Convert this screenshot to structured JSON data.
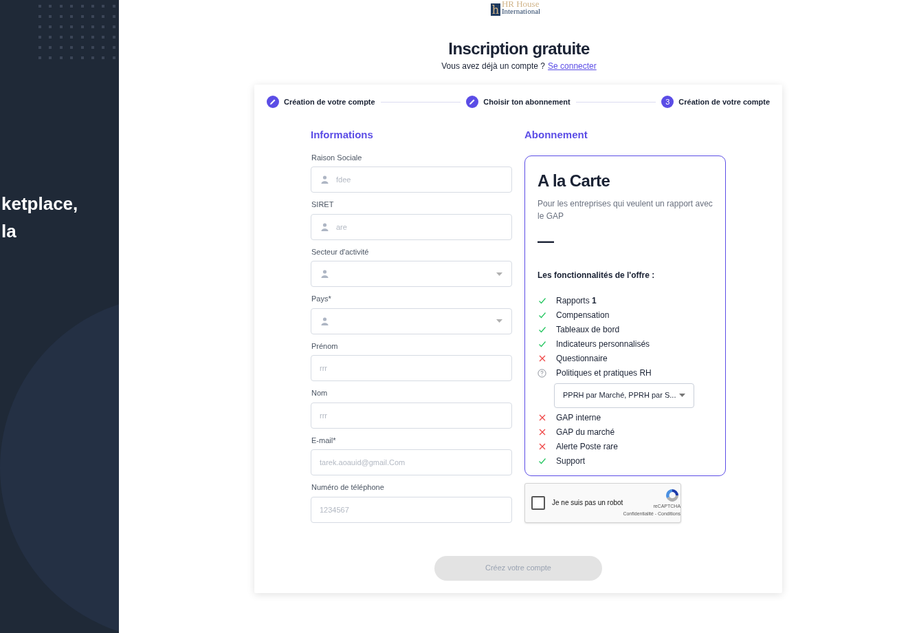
{
  "left_panel": {
    "text_lines": [
      "ketplace,",
      "la"
    ]
  },
  "logo": {
    "mark": "h",
    "name": "HR House",
    "subtitle": "International"
  },
  "header": {
    "title": "Inscription gratuite",
    "question": "Vous avez déjà un compte ?",
    "link": "Se connecter"
  },
  "steps": [
    {
      "label": "Création de votre compte",
      "done": true
    },
    {
      "label": "Choisir ton abonnement",
      "done": true
    },
    {
      "label": "Création de votre compte",
      "done": false,
      "number": "3"
    }
  ],
  "informations": {
    "title": "Informations",
    "fields": [
      {
        "kind": "text",
        "label": "Raison Sociale",
        "placeholder": "fdee",
        "icon": true
      },
      {
        "kind": "text",
        "label": "SIRET",
        "placeholder": "are",
        "icon": true
      },
      {
        "kind": "select",
        "label": "Secteur d'activité",
        "icon": true
      },
      {
        "kind": "select",
        "label": "Pays*",
        "icon": true
      },
      {
        "kind": "text",
        "label": "Prénom",
        "placeholder": "rrr",
        "icon": false
      },
      {
        "kind": "text",
        "label": "Nom",
        "placeholder": "rrr",
        "icon": false
      },
      {
        "kind": "text",
        "label": "E-mail*",
        "placeholder": "tarek.aoauid@gmail.Com",
        "icon": false
      },
      {
        "kind": "text",
        "label": "Numéro de téléphone",
        "placeholder": "1234567",
        "icon": false
      }
    ]
  },
  "abonnement": {
    "title": "Abonnement",
    "plan": {
      "name": "A la Carte",
      "description": "Pour les entreprises qui veulent un rapport avec le GAP",
      "price": "—",
      "features_title": "Les fonctionnalités de l'offre :",
      "features": [
        {
          "kind": "yes",
          "label": "Rapports **1**"
        },
        {
          "kind": "yes",
          "label": "Compensation"
        },
        {
          "kind": "yes",
          "label": "Tableaux de bord"
        },
        {
          "kind": "yes",
          "label": "Indicateurs personnalisés"
        },
        {
          "kind": "no",
          "label": "Questionnaire"
        },
        {
          "kind": "info",
          "label": "Politiques et pratiques RH",
          "select": "PPRH par Marché, PPRH par S..."
        },
        {
          "kind": "no",
          "label": "GAP interne"
        },
        {
          "kind": "no",
          "label": "GAP du marché"
        },
        {
          "kind": "no",
          "label": "Alerte Poste rare"
        },
        {
          "kind": "yes",
          "label": "Support"
        }
      ]
    }
  },
  "captcha": {
    "checked": false,
    "label": "Je ne suis pas un robot",
    "brand": "reCAPTCHA",
    "links": "Confidentialité - Conditions"
  },
  "submit": {
    "label": "Créez votre compte",
    "disabled": true
  }
}
